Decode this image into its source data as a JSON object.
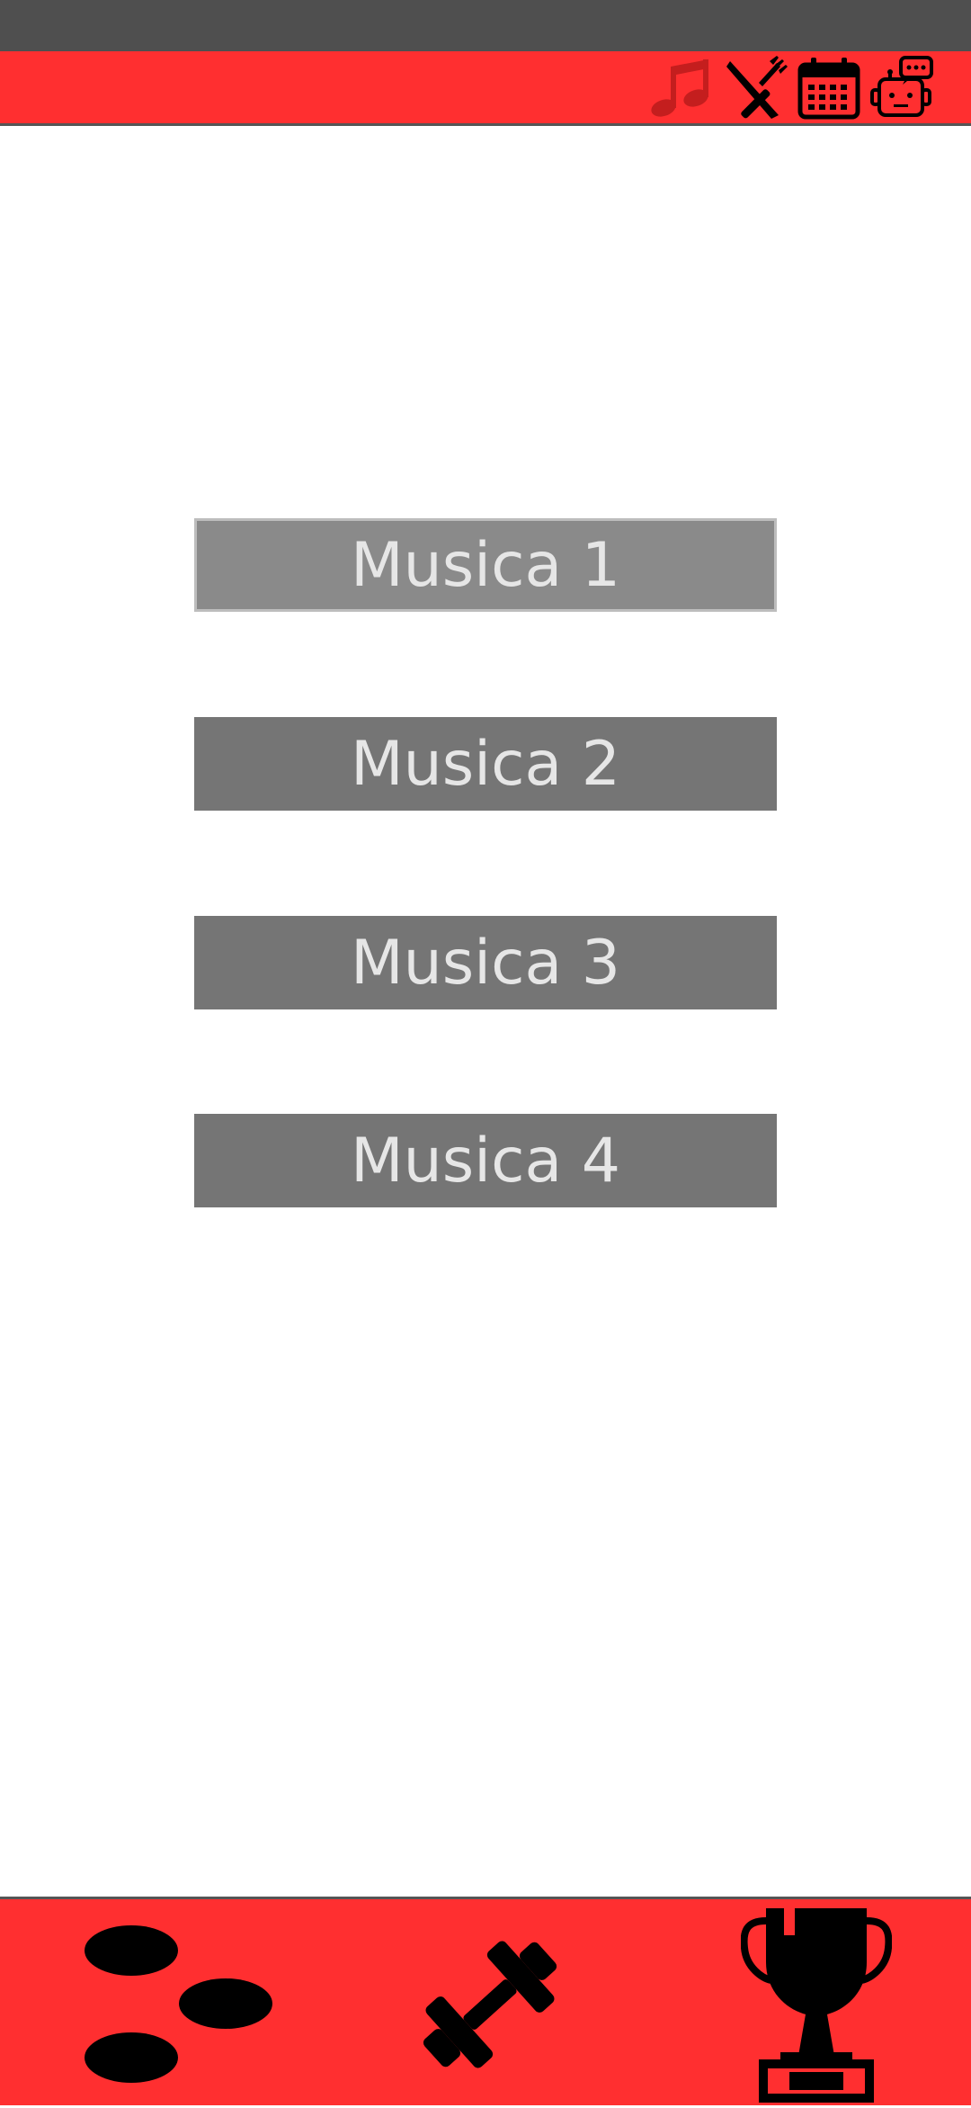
{
  "top_bar": {
    "icons": [
      "music-note-icon",
      "utensils-icon",
      "calendar-icon",
      "chat-robot-icon"
    ],
    "accent_color": "#ff2f30",
    "active_icon_color": "#c41e1e"
  },
  "content": {
    "buttons": [
      {
        "label": "Musica 1",
        "state": "pressed"
      },
      {
        "label": "Musica 2",
        "state": "default"
      },
      {
        "label": "Musica 3",
        "state": "default"
      },
      {
        "label": "Musica 4",
        "state": "default"
      }
    ],
    "button_color": "#757575",
    "button_text_color": "#e6e6e6"
  },
  "bottom_nav": {
    "icons": [
      "footsteps-icon",
      "dumbbell-icon",
      "trophy-icon"
    ]
  }
}
